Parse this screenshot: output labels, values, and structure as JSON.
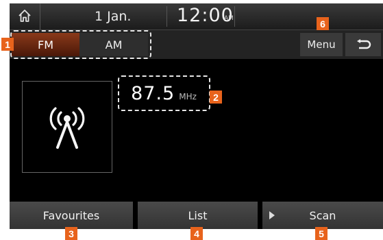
{
  "status_bar": {
    "date": "1 Jan.",
    "time": "12:00",
    "ampm": "AM"
  },
  "band_tabs": [
    {
      "label": "FM",
      "selected": true
    },
    {
      "label": "AM",
      "selected": false
    }
  ],
  "header_buttons": {
    "menu_label": "Menu"
  },
  "station": {
    "frequency": "87.5",
    "unit": "MHz"
  },
  "bottom_buttons": {
    "favourites_label": "Favourites",
    "list_label": "List",
    "scan_label": "Scan"
  },
  "callouts": {
    "band": "1",
    "frequency": "2",
    "favourites": "3",
    "list": "4",
    "scan": "5",
    "menu": "6"
  },
  "colors": {
    "accent": "#e8631c",
    "selected_band": "#8a3a1a",
    "background": "#000000"
  }
}
